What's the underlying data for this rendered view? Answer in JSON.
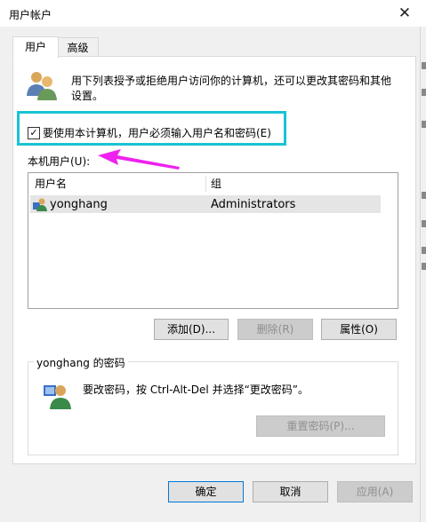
{
  "window": {
    "title": "用户帐户",
    "close_glyph": "✕"
  },
  "tabs": [
    {
      "label": "用户"
    },
    {
      "label": "高级"
    }
  ],
  "description": "用下列表授予或拒绝用户访问你的计算机，还可以更改其密码和其他设置。",
  "require_login_checkbox": {
    "label": "要使用本计算机，用户必须输入用户名和密码(E)",
    "checked": true
  },
  "local_users": {
    "label": "本机用户(U):",
    "columns": [
      "用户名",
      "组"
    ],
    "rows": [
      {
        "username": "yonghang",
        "group": "Administrators"
      }
    ]
  },
  "user_buttons": {
    "add": "添加(D)...",
    "remove": "删除(R)",
    "properties": "属性(O)"
  },
  "password_group": {
    "title": "yonghang 的密码",
    "text": "要改密码，按 Ctrl-Alt-Del 并选择“更改密码”。",
    "reset_button": "重置密码(P)..."
  },
  "footer_buttons": {
    "ok": "确定",
    "cancel": "取消",
    "apply": "应用(A)"
  },
  "colors": {
    "highlight": "#19c3d3",
    "arrow": "#ee22ee",
    "default_button_border": "#0078d7"
  },
  "icons": {
    "users": "users-icon",
    "user": "user-icon",
    "user_password": "user-password-icon",
    "arrow": "arrow-annotation"
  }
}
